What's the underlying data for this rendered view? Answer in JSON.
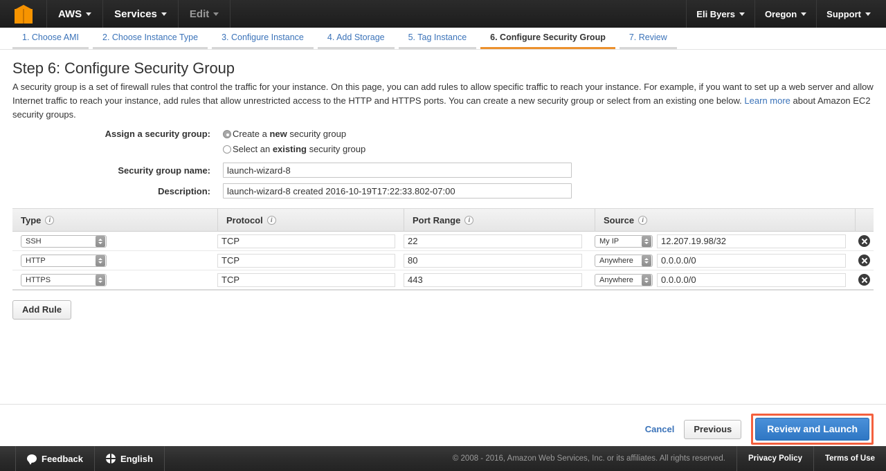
{
  "topnav": {
    "logo": "aws-cube-logo",
    "left_items": [
      {
        "label": "AWS",
        "has_caret": true,
        "dim": false
      },
      {
        "label": "Services",
        "has_caret": true,
        "dim": false
      },
      {
        "label": "Edit",
        "has_caret": true,
        "dim": true
      }
    ],
    "right_items": [
      {
        "label": "Eli Byers",
        "has_caret": true
      },
      {
        "label": "Oregon",
        "has_caret": true
      },
      {
        "label": "Support",
        "has_caret": true
      }
    ]
  },
  "steps": [
    {
      "label": "1. Choose AMI",
      "active": false
    },
    {
      "label": "2. Choose Instance Type",
      "active": false
    },
    {
      "label": "3. Configure Instance",
      "active": false
    },
    {
      "label": "4. Add Storage",
      "active": false
    },
    {
      "label": "5. Tag Instance",
      "active": false
    },
    {
      "label": "6. Configure Security Group",
      "active": true
    },
    {
      "label": "7. Review",
      "active": false
    }
  ],
  "page": {
    "title": "Step 6: Configure Security Group",
    "intro_part1": "A security group is a set of firewall rules that control the traffic for your instance. On this page, you can add rules to allow specific traffic to reach your instance. For example, if you want to set up a web server and allow Internet traffic to reach your instance, add rules that allow unrestricted access to the HTTP and HTTPS ports. You can create a new security group or select from an existing one below.",
    "learn_more": "Learn more",
    "intro_part2": "about Amazon EC2 security groups."
  },
  "form": {
    "assign_label": "Assign a security group:",
    "option_new_pre": "Create a ",
    "option_new_bold": "new",
    "option_new_post": " security group",
    "option_new_selected": true,
    "option_existing_pre": "Select an ",
    "option_existing_bold": "existing",
    "option_existing_post": " security group",
    "option_existing_selected": false,
    "name_label": "Security group name:",
    "name_value": "launch-wizard-8",
    "description_label": "Description:",
    "description_value": "launch-wizard-8 created 2016-10-19T17:22:33.802-07:00"
  },
  "table": {
    "headers": [
      {
        "label": "Type",
        "info": true
      },
      {
        "label": "Protocol",
        "info": true
      },
      {
        "label": "Port Range",
        "info": true
      },
      {
        "label": "Source",
        "info": true
      }
    ],
    "rows": [
      {
        "type": "SSH",
        "protocol": "TCP",
        "port": "22",
        "source_kind": "My IP",
        "source_value": "12.207.19.98/32"
      },
      {
        "type": "HTTP",
        "protocol": "TCP",
        "port": "80",
        "source_kind": "Anywhere",
        "source_value": "0.0.0.0/0"
      },
      {
        "type": "HTTPS",
        "protocol": "TCP",
        "port": "443",
        "source_kind": "Anywhere",
        "source_value": "0.0.0.0/0"
      }
    ],
    "delete_icon": "delete-circle-x-icon"
  },
  "actions": {
    "add_rule": "Add Rule",
    "cancel": "Cancel",
    "previous": "Previous",
    "review_and_launch": "Review and Launch",
    "highlight_color": "#f4603e",
    "primary_color": "#3a82cc"
  },
  "bottombar": {
    "feedback": "Feedback",
    "language": "English",
    "copyright": "© 2008 - 2016, Amazon Web Services, Inc. or its affiliates. All rights reserved.",
    "privacy_policy": "Privacy Policy",
    "terms_of_use": "Terms of Use"
  }
}
